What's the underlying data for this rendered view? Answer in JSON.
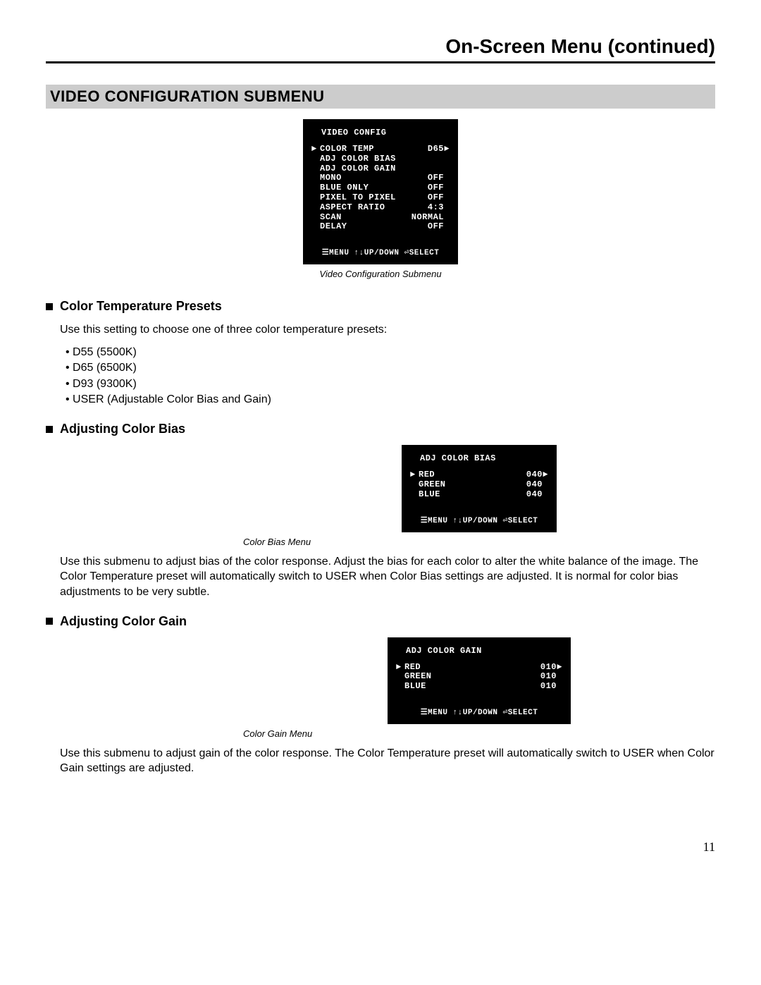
{
  "page": {
    "title": "On-Screen Menu (continued)",
    "section_header": "VIDEO CONFIGURATION SUBMENU",
    "page_number": "11"
  },
  "osd_video_config": {
    "title": "VIDEO CONFIG",
    "caption": "Video Configuration Submenu",
    "rows": [
      {
        "label": "COLOR TEMP",
        "value": "D65",
        "selected": true,
        "tail": "►"
      },
      {
        "label": "ADJ COLOR BIAS",
        "value": ""
      },
      {
        "label": "ADJ COLOR GAIN",
        "value": ""
      },
      {
        "label": "MONO",
        "value": "OFF"
      },
      {
        "label": "BLUE ONLY",
        "value": "OFF"
      },
      {
        "label": "PIXEL TO PIXEL",
        "value": "OFF"
      },
      {
        "label": "ASPECT RATIO",
        "value": "4:3"
      },
      {
        "label": "SCAN",
        "value": "NORMAL"
      },
      {
        "label": "DELAY",
        "value": "OFF"
      }
    ],
    "footer": "☰MENU ↑↓UP/DOWN ⏎SELECT"
  },
  "section_color_temp": {
    "heading": "Color Temperature Presets",
    "intro": "Use this setting to choose one of three color temperature presets:",
    "items": [
      "D55 (5500K)",
      "D65 (6500K)",
      "D93 (9300K)",
      "USER (Adjustable Color Bias and Gain)"
    ]
  },
  "section_color_bias": {
    "heading": "Adjusting Color Bias",
    "osd": {
      "title": "ADJ COLOR BIAS",
      "caption": "Color Bias Menu",
      "rows": [
        {
          "label": "RED",
          "value": "040",
          "selected": true,
          "tail": "►"
        },
        {
          "label": "GREEN",
          "value": "040"
        },
        {
          "label": "BLUE",
          "value": "040"
        }
      ],
      "footer": "☰MENU ↑↓UP/DOWN ⏎SELECT"
    },
    "body": "Use this submenu to adjust bias of the color response. Adjust the bias for each color to alter the white balance of the image. The Color Temperature preset will automatically switch to USER when Color Bias settings are adjusted. It is normal for color bias adjustments to be very subtle."
  },
  "section_color_gain": {
    "heading": "Adjusting Color Gain",
    "osd": {
      "title": "ADJ COLOR GAIN",
      "caption": "Color Gain Menu",
      "rows": [
        {
          "label": "RED",
          "value": "010",
          "selected": true,
          "tail": "►"
        },
        {
          "label": "GREEN",
          "value": "010"
        },
        {
          "label": "BLUE",
          "value": "010"
        }
      ],
      "footer": "☰MENU ↑↓UP/DOWN ⏎SELECT"
    },
    "body": "Use this submenu to adjust gain of the color response. The Color Temperature preset will automatically switch to USER when Color Gain settings are adjusted."
  }
}
